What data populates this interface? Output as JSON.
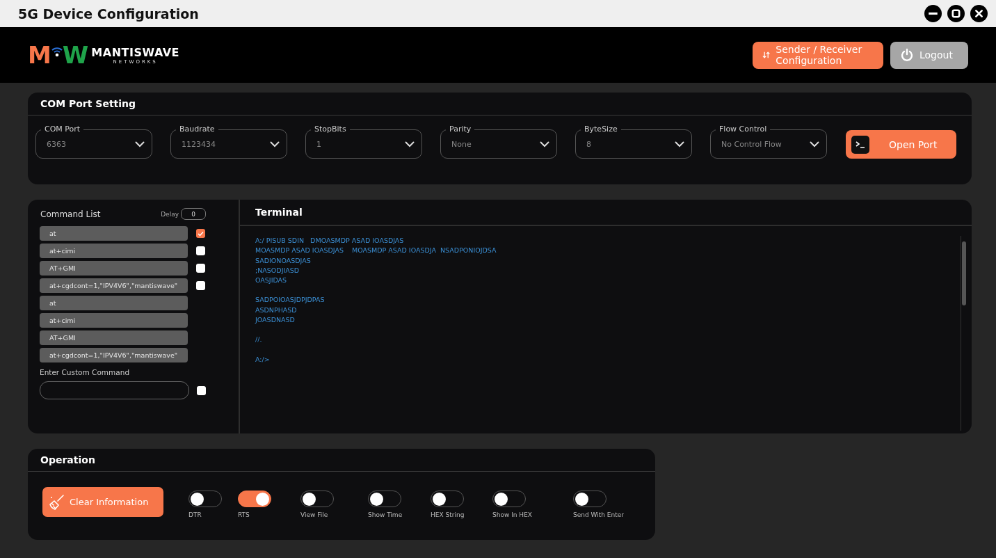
{
  "window": {
    "title": "5G Device Configuration"
  },
  "header": {
    "logo": {
      "letters": [
        "M",
        "W"
      ],
      "name": "MANTISWAVE",
      "tagline": "NETWORKS"
    },
    "buttons": [
      {
        "label": "Sender / Receiver Configuration",
        "kind": "primary"
      },
      {
        "label": "Logout",
        "kind": "secondary"
      }
    ]
  },
  "com_port_setting": {
    "title": "COM Port Setting",
    "fields": [
      {
        "label": "COM Port",
        "value": "6363"
      },
      {
        "label": "Baudrate",
        "value": "1123434"
      },
      {
        "label": "StopBits",
        "value": "1"
      },
      {
        "label": "Parity",
        "value": "None"
      },
      {
        "label": "ByteSize",
        "value": "8"
      },
      {
        "label": "Flow Control",
        "value": "No Control Flow"
      }
    ],
    "open_button": "Open Port"
  },
  "command_list": {
    "title": "Command List",
    "delay_label": "Delay",
    "delay_value": "0",
    "commands": [
      {
        "text": "at",
        "checked": true
      },
      {
        "text": "at+cimi",
        "checked": false
      },
      {
        "text": "AT+GMI",
        "checked": false
      },
      {
        "text": "at+cgdcont=1,\"IPV4V6\",\"mantiswave\"",
        "checked": false
      },
      {
        "text": "at"
      },
      {
        "text": "at+cimi"
      },
      {
        "text": "AT+GMI"
      },
      {
        "text": "at+cgdcont=1,\"IPV4V6\",\"mantiswave\""
      }
    ],
    "custom_label": "Enter Custom Command",
    "custom_checked": false
  },
  "terminal": {
    "title": "Terminal",
    "blocks": [
      [
        "A:/ PISUB SDIN   DMOASMDP ASAD IOASDJAS",
        "MOASMDP ASAD IOASDJAS    MOASMDP ASAD IOASDJA  NSADPONIOJDSA",
        "SADIONOASDJAS",
        ";NASODJIASD",
        "OASJIDAS"
      ],
      [
        "SADPOIOASJDPJDPAS",
        "ASDNPHASD",
        "JOASDNASD"
      ],
      [
        "//."
      ],
      [
        "A:/>"
      ]
    ]
  },
  "operation": {
    "title": "Operation",
    "clear_button": "Clear Information",
    "toggles": [
      {
        "label": "DTR",
        "on": false
      },
      {
        "label": "RTS",
        "on": true
      },
      {
        "label": "View File",
        "on": false
      },
      {
        "label": "Show Time",
        "on": false
      },
      {
        "label": "HEX String",
        "on": false
      },
      {
        "label": "Show In HEX",
        "on": false
      },
      {
        "label": "Send With Enter",
        "on": false
      }
    ]
  }
}
